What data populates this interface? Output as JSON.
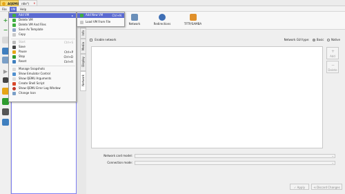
{
  "window": {
    "app_tab": "AQEMU",
    "doc_tab": "rdle\")",
    "doc_tab_close": "x"
  },
  "menubar": {
    "file": "File",
    "vm": "VM",
    "help": "Help"
  },
  "vm_menu": {
    "items": [
      {
        "label": "Add VM",
        "shortcut": "",
        "icon": "add-icon",
        "has_submenu": true,
        "highlighted": true,
        "disabled": false
      },
      {
        "label": "Delete VM",
        "shortcut": "",
        "icon": "delete-icon",
        "disabled": false
      },
      {
        "label": "Delete VM And Files",
        "shortcut": "",
        "icon": "delete-files-icon",
        "disabled": false
      },
      {
        "label": "Save As Template",
        "shortcut": "",
        "icon": "template-icon",
        "disabled": false
      },
      {
        "label": "Copy",
        "shortcut": "",
        "icon": "copy-icon",
        "disabled": false
      },
      {
        "label": "Start",
        "shortcut": "Ctrl+S",
        "icon": "play-icon",
        "disabled": true
      },
      {
        "label": "Save",
        "shortcut": "",
        "icon": "save-icon",
        "disabled": false
      },
      {
        "label": "Pause",
        "shortcut": "Ctrl+P",
        "icon": "pause-icon",
        "disabled": false
      },
      {
        "label": "Stop",
        "shortcut": "Ctrl+D",
        "icon": "stop-icon",
        "disabled": false
      },
      {
        "label": "Reset",
        "shortcut": "Ctrl+R",
        "icon": "reset-icon",
        "disabled": false
      },
      {
        "label": "Manage Snapshots",
        "shortcut": "",
        "icon": "snapshots-icon",
        "disabled": false
      },
      {
        "label": "Show Emulator Control",
        "shortcut": "",
        "icon": "emulator-control-icon",
        "disabled": false
      },
      {
        "label": "Show QEMU Arguments",
        "shortcut": "",
        "icon": "arguments-icon",
        "disabled": false
      },
      {
        "label": "Create Shell Script",
        "shortcut": "",
        "icon": "script-icon",
        "disabled": false
      },
      {
        "label": "Show QEMU Error Log Window",
        "shortcut": "",
        "icon": "error-log-icon",
        "disabled": false
      },
      {
        "label": "Change Icon",
        "shortcut": "",
        "icon": "change-icon-icon",
        "disabled": false
      }
    ]
  },
  "add_vm_submenu": {
    "items": [
      {
        "label": "Add New VM",
        "shortcut": "Ctrl+N",
        "icon": "new-vm-icon",
        "highlighted": true
      },
      {
        "label": "Load VM From File",
        "shortcut": "",
        "icon": "load-vm-icon",
        "highlighted": false
      }
    ]
  },
  "top_tabs": [
    {
      "label": "Network",
      "icon": "network-icon"
    },
    {
      "label": "Redirections",
      "icon": "redirections-icon"
    },
    {
      "label": "TFTP/SAMBA",
      "icon": "tftp-samba-icon"
    }
  ],
  "side_tabs": [
    {
      "label": "Info",
      "selected": false
    },
    {
      "label": "Media",
      "selected": false
    },
    {
      "label": "Display",
      "selected": false
    },
    {
      "label": "Network",
      "selected": true
    }
  ],
  "network": {
    "enable_label": "Enable network",
    "enable_checked": false,
    "gui_type_label": "Network GUI type:",
    "gui_options": [
      {
        "label": "Basic",
        "selected": true
      },
      {
        "label": "Native",
        "selected": false
      }
    ],
    "add_label": "Add",
    "delete_label": "Delete",
    "card_model_label": "Network card model:",
    "card_model_value": "",
    "connection_mode_label": "Connection mode:",
    "connection_mode_value": ""
  },
  "buttons": {
    "apply": "Apply",
    "discard": "Discard Changes"
  },
  "colors": {
    "accent": "#5b6ad0",
    "app_tab": "#f5d76e",
    "vm_list_border": "#7d7df0"
  }
}
